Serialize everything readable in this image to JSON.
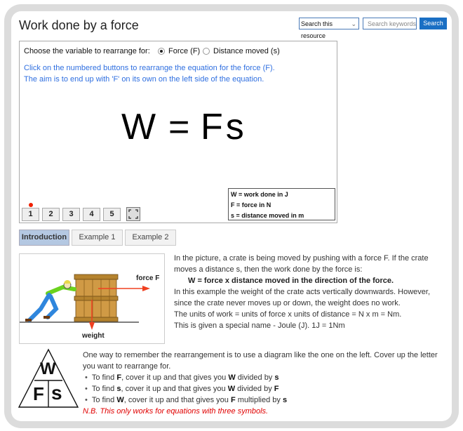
{
  "header": {
    "title": "Work done by a force",
    "search_scope": "Search this resource",
    "search_placeholder": "Search keywords.",
    "search_button": "Search"
  },
  "applet": {
    "choose_label": "Choose the variable to rearrange for:",
    "options": [
      {
        "label": "Force (F)",
        "selected": true
      },
      {
        "label": "Distance moved (s)",
        "selected": false
      }
    ],
    "instructions": [
      "Click on the numbered buttons to rearrange the equation for the force (F).",
      "The aim is to end up with 'F' on its own on the left side of the equation."
    ],
    "equation": {
      "left": "W",
      "equals": "=",
      "right": "Fs"
    },
    "legend": [
      "W = work done in J",
      "F = force in N",
      "s = distance moved  in m"
    ],
    "step_buttons": [
      "1",
      "2",
      "3",
      "4",
      "5"
    ],
    "current_step": 1,
    "fullscreen_icon": "fullscreen-icon",
    "indicator_color": "#f02000"
  },
  "tabs": [
    {
      "label": "Introduction",
      "active": true
    },
    {
      "label": "Example 1",
      "active": false
    },
    {
      "label": "Example 2",
      "active": false
    }
  ],
  "picture": {
    "force_label": "force F",
    "weight_label": "weight"
  },
  "intro": {
    "p1": "In the picture, a crate is being moved by pushing with a force F. If the crate moves a distance s, then the work done by the force is:",
    "formula": "W = force x distance moved in the direction of the force.",
    "p2": "In this example the weight of the crate acts vertically downwards. However, since the crate never moves up or down, the weight does no work.",
    "p3": "The units of work = units of force x units of distance = N x m = Nm.",
    "p4": "This is given a special name - Joule (J). 1J = 1Nm"
  },
  "triangle": {
    "top": "W",
    "bottom_left": "F",
    "bottom_right": "s"
  },
  "memory": {
    "intro": "One way to remember the rearrangement is to use a diagram like the one on the left. Cover up the letter you want to rearrange for.",
    "items": [
      {
        "pre": "To find ",
        "var": "F",
        "mid": ", cover it up and that gives you ",
        "a": "W",
        "op": " divided by ",
        "b": "s"
      },
      {
        "pre": "To find ",
        "var": "s",
        "mid": ", cover it up and that gives you ",
        "a": "W",
        "op": " divided by ",
        "b": "F"
      },
      {
        "pre": "To find ",
        "var": "W",
        "mid": ", cover it up and that gives you ",
        "a": "F",
        "op": " multiplied by ",
        "b": "s"
      }
    ],
    "note": "N.B. This only works for equations with three symbols."
  },
  "colors": {
    "accent": "#1a6fc4",
    "instruction_text": "#2f6fe0",
    "active_tab": "#b4c8e2",
    "note_red": "#e00000",
    "arrow_red": "#f04020"
  }
}
